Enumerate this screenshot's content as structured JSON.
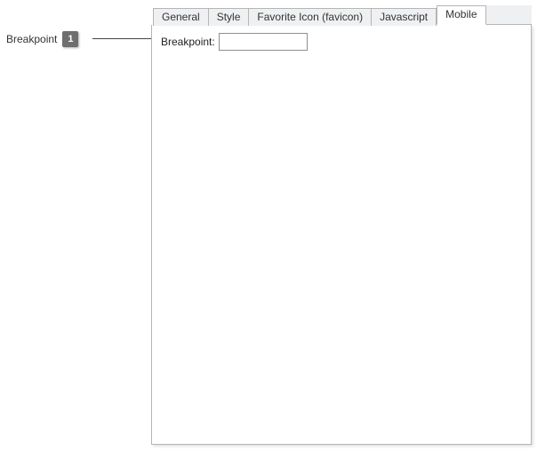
{
  "callout": {
    "label": "Breakpoint",
    "number": "1"
  },
  "tabs": [
    {
      "label": "General"
    },
    {
      "label": "Style"
    },
    {
      "label": "Favorite Icon (favicon)"
    },
    {
      "label": "Javascript"
    },
    {
      "label": "Mobile"
    }
  ],
  "activeTabIndex": 4,
  "form": {
    "breakpoint": {
      "label": "Breakpoint:",
      "value": ""
    }
  }
}
